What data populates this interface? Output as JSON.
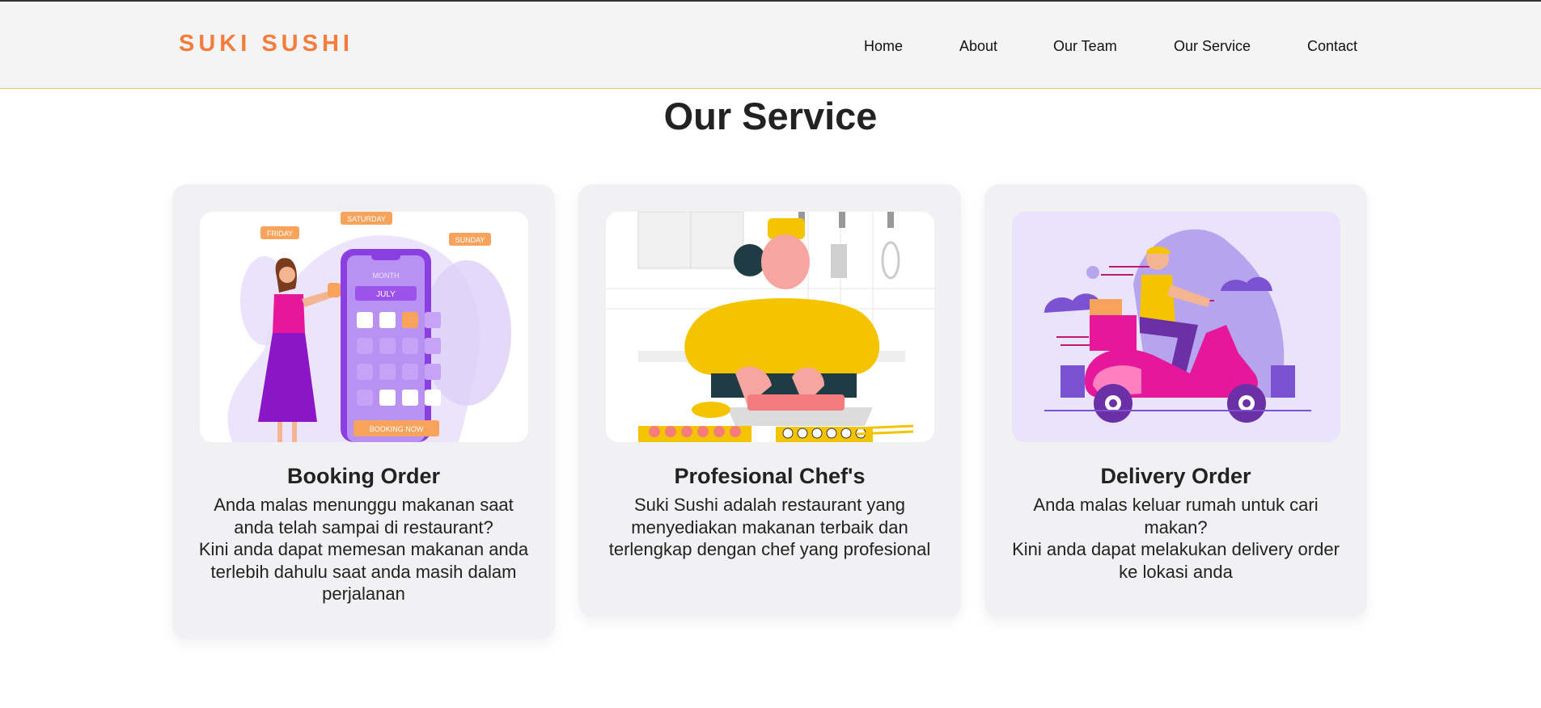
{
  "brand": {
    "name": "SUKI SUSHI",
    "color": "#f47c3c"
  },
  "nav": {
    "items": [
      {
        "label": "Home"
      },
      {
        "label": "About"
      },
      {
        "label": "Our Team"
      },
      {
        "label": "Our Service"
      },
      {
        "label": "Contact"
      }
    ]
  },
  "service": {
    "title": "Our Service",
    "cards": [
      {
        "title": "Booking Order",
        "desc": [
          "Anda malas menunggu makanan saat anda telah sampai di restaurant?",
          "Kini anda dapat memesan makanan anda terlebih dahulu saat anda masih dalam perjalanan"
        ],
        "illustration": {
          "labels": [
            "SATURDAY",
            "FRIDAY",
            "SUNDAY",
            "MONTH",
            "JULY",
            "BOOKING NOW"
          ]
        }
      },
      {
        "title": "Profesional Chef's",
        "desc": [
          "Suki Sushi adalah restaurant yang menyediakan makanan terbaik dan terlengkap dengan chef yang profesional"
        ]
      },
      {
        "title": "Delivery Order",
        "desc": [
          "Anda malas keluar rumah untuk cari makan?",
          "Kini anda dapat melakukan delivery order ke lokasi anda"
        ]
      }
    ]
  }
}
